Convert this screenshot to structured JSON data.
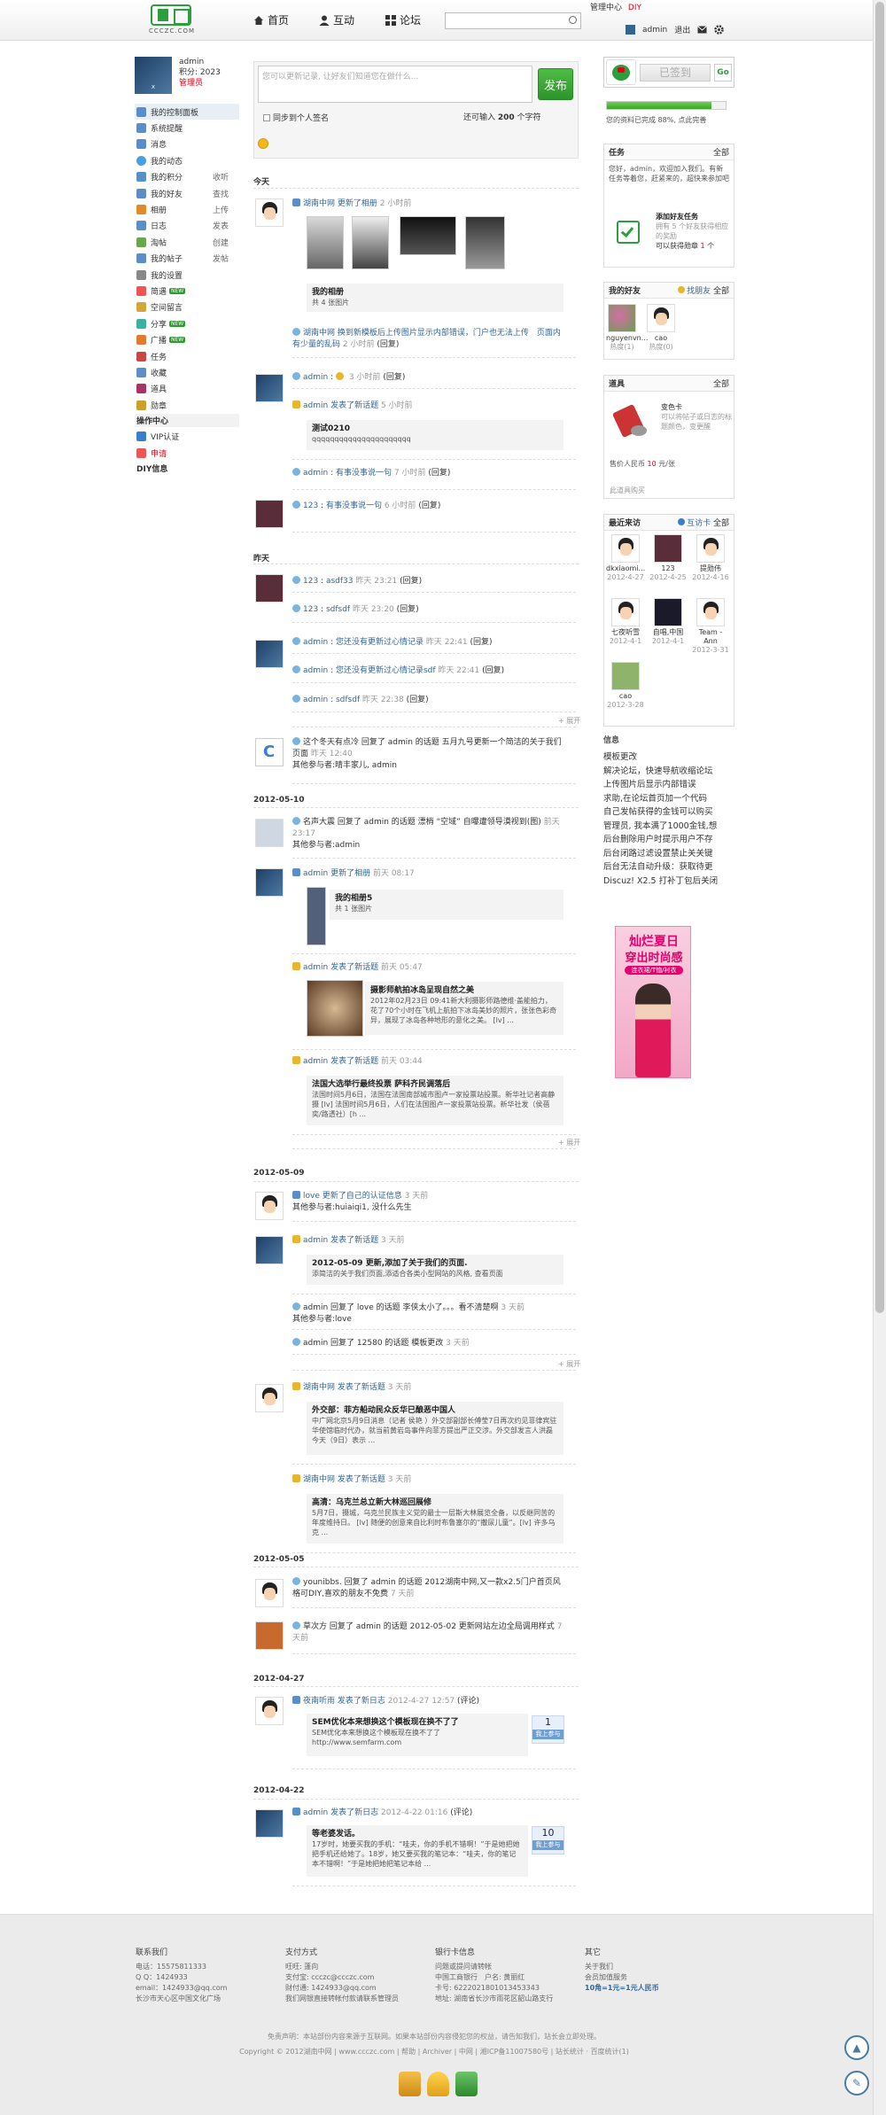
{
  "header": {
    "logo_sub": "CCCZC.COM",
    "nav": [
      "首页",
      "互动",
      "论坛"
    ],
    "search_placeholder": "",
    "toplinks": [
      "管理中心",
      "DIY"
    ],
    "username": "admin",
    "exit": "退出"
  },
  "profile": {
    "name": "admin",
    "points": "积分: 2023",
    "role": "管理员"
  },
  "menu": {
    "items": [
      {
        "label": "我的控制面板",
        "right": ""
      },
      {
        "label": "系统提醒",
        "right": ""
      },
      {
        "label": "消息",
        "right": ""
      },
      {
        "label": "我的动态",
        "right": ""
      },
      {
        "label": "我的积分",
        "right": "收听"
      },
      {
        "label": "我的好友",
        "right": "查找"
      },
      {
        "label": "相册",
        "right": "上传"
      },
      {
        "label": "日志",
        "right": "发表"
      },
      {
        "label": "淘帖",
        "right": "创建"
      },
      {
        "label": "我的帖子",
        "right": "发帖"
      },
      {
        "label": "我的设置",
        "right": ""
      },
      {
        "label": "简遇",
        "right": "",
        "new": "NEW"
      },
      {
        "label": "空间留言",
        "right": ""
      },
      {
        "label": "分享",
        "right": "",
        "new": "NEW"
      },
      {
        "label": "广播",
        "right": "",
        "new": "NEW"
      },
      {
        "label": "任务",
        "right": ""
      },
      {
        "label": "收藏",
        "right": ""
      },
      {
        "label": "道具",
        "right": ""
      },
      {
        "label": "勋章",
        "right": ""
      }
    ],
    "section": "操作中心",
    "ops": [
      "VIP认证",
      "申请"
    ],
    "diy": "DIY信息"
  },
  "publish": {
    "placeholder": "您可以更新记录, 让好友们知道您在做什么...",
    "button": "发布",
    "sync": "同步到个人签名",
    "count_pre": "还可输入 ",
    "count": "200",
    "count_post": " 个字符"
  },
  "days": [
    "今天",
    "昨天",
    "2012-05-10",
    "2012-05-09",
    "2012-05-05",
    "2012-04-27",
    "2012-04-22"
  ],
  "feed": {
    "f1": {
      "user": "湖南中网",
      "action": "更新了相册",
      "time": "2 小时前",
      "album": "我的相册",
      "album_sub": "共 4 张图片"
    },
    "f2": {
      "user": "湖南中网",
      "link": "换到新模板后上传图片显示内部错误，门户也无法上传　页面内有少量的乱码",
      "time": "2 小时前",
      "tail": "(回复)"
    },
    "f3": {
      "user": "admin",
      "time": "3 小时前",
      "tail": "(回复)"
    },
    "f4": {
      "user": "admin",
      "action": "发表了新话题",
      "time": "5 小时前",
      "title": "测试0210",
      "body": "qqqqqqqqqqqqqqqqqqqqqq"
    },
    "f5": {
      "user": "admin",
      "link": "有事没事说一句",
      "time": "7 小时前",
      "tail": "(回复)"
    },
    "f6": {
      "user": "123",
      "link": "有事没事说一句",
      "time": "6 小时前",
      "tail": "(回复)"
    },
    "y1": {
      "user": "123",
      "link": "asdf33",
      "time": "昨天 23:21",
      "tail": "(回复)"
    },
    "y2": {
      "user": "123",
      "link": "sdfsdf",
      "time": "昨天 23:20",
      "tail": "(回复)"
    },
    "y3": {
      "user": "admin",
      "link": "您还没有更新过心情记录",
      "time": "昨天 22:41",
      "tail": "(回复)"
    },
    "y4": {
      "user": "admin",
      "link": "您还没有更新过心情记录sdf",
      "time": "昨天 22:41",
      "tail": "(回复)"
    },
    "y5": {
      "user": "admin",
      "link": "sdfsdf",
      "time": "昨天 22:38",
      "tail": "(回复)"
    },
    "expand": "展开",
    "c1": {
      "text": "这个冬天有点冷 回复了 admin 的话题 五月九号更新一个简洁的关于我们页面",
      "time": "昨天 12:40",
      "sub": "其他参与者:晴丰家儿, admin"
    },
    "d1": {
      "text": "名声大震 回复了 admin 的话题 漂梢 “空域” 自曝遭领导漠视到(图)",
      "time": "前天 23:17",
      "sub": "其他参与者:admin"
    },
    "d2": {
      "user": "admin",
      "action": "更新了相册",
      "time": "前天 08:17",
      "album": "我的相册5",
      "album_sub": "共 1 张图片"
    },
    "d3": {
      "user": "admin",
      "action": "发表了新话题",
      "time": "前天 05:47",
      "title": "摄影师航拍冰岛呈现自然之美",
      "body": "2012年02月23日 09:41新大利摄影师路德维·盖能拍力，花了70个小时在飞机上航拍下冰岛美妙的照片，张张色彩奇异，展现了冰岛各种地形的意化之美。 [lv] ..."
    },
    "d4": {
      "user": "admin",
      "action": "发表了新话题",
      "time": "前天 03:44",
      "title": "法国大选举行最终投票 萨科齐民调落后",
      "body": "法国时间5月6日，法国在法国南部城市图卢一家投票站投票。新华社记者高静摄 [lv] 法国时间5月6日，人们在法国图卢一家投票站投票。新华社发（侯蓓奕/路透社）[h ..."
    },
    "e1": {
      "user": "love",
      "action": "更新了自己的认证信息",
      "time": "3 天前",
      "sub": "其他参与者:huiaiqi1, 没什么先生"
    },
    "e2": {
      "user": "admin",
      "action": "发表了新话题",
      "time": "3 天前",
      "title": "2012-05-09 更新,添加了关于我们的页面.",
      "body": "添简洁的关于我们页面,添适合各类小型网站的风格, 查看页面"
    },
    "e3": {
      "text": "admin 回复了 love 的话题 李侠太小了。。。看不清楚啊",
      "time": "3 天前",
      "sub": "其他参与者:love"
    },
    "e4": {
      "text": "admin 回复了 12580 的话题 模板更改",
      "time": "3 天前"
    },
    "e5": {
      "user": "湖南中网",
      "action": "发表了新话题",
      "time": "3 天前",
      "title": "外交部：菲方船动民众反华已酿恶中国人",
      "body": "中广网北京5月9日消息（记者 侯艳 ）外交部副部长傅莹7日再次约见菲律宾驻华使馆临时代办，就当前黄岩岛事件向菲方提出严正交涉。外交部发言人洪磊今天（9日）表示 ..."
    },
    "e6": {
      "user": "湖南中网",
      "action": "发表了新话题",
      "time": "3 天前",
      "title": "高清：乌克兰总立新大林巡回展修",
      "body": "5月7日，摄城，乌克兰民族主义党的最士一层斯大林展览全备，以反继同苦的年度维持日。 [lv] 随便的创意来自比利时布鲁塞尔的“撒尿儿童”。[lv] 许多乌克 ..."
    },
    "g1": {
      "text": "younibbs. 回复了 admin 的话题 2012湖南中网,又一款x2.5门户首页风格可DIY,喜欢的朋友不免费",
      "time": "7 天前"
    },
    "g2": {
      "text": "草次方 回复了 admin 的话题 2012-05-02 更新网站左边全局调用样式",
      "time": "7 天前"
    },
    "h1": {
      "user": "夜南听雨",
      "action": "发表了新日志",
      "time": "2012-4-27 12:57",
      "tail": "(评论)",
      "title": "SEM优化本来想换这个模板现在换不了了",
      "body": "SEM优化本来想换这个模板现在换不了了",
      "url": "http://www.semfarm.com",
      "vote": "1",
      "vote_label": "我上参与"
    },
    "i1": {
      "user": "admin",
      "action": "发表了新日志",
      "time": "2012-4-22 01:16",
      "tail": "(评论)",
      "title": "等老婆发话。",
      "body": "17岁时，她要买我的手机：“哇夫，你的手机不错啊！”于是她把她把手机还给她了。18岁，她又要买我的笔记本：“哇夫，你的笔记本不错啊！”于是她把她把笔记本给 ...",
      "vote": "10",
      "vote_label": "我上参与"
    }
  },
  "right": {
    "sign": "已签到",
    "sign_go": "Go",
    "progress": 0.88,
    "progress_text": "您的资料已完成 88%, 点此完善",
    "tasks": {
      "title": "任务",
      "all": "全部",
      "intro": "您好，admin，欢迎加入我们。有新任务等着您，赶紧来的，超快来参加吧",
      "task_name": "添加好友任务",
      "task_desc": "拥有 5 个好友获得相应的奖励",
      "task_reward_pre": "可以获得勋章 ",
      "task_reward": "1",
      "task_reward_post": " 个"
    },
    "friends": {
      "title": "我的好友",
      "search": "找朋友",
      "all": "全部",
      "list": [
        {
          "name": "nguyenvn...",
          "sub": "热度(1)"
        },
        {
          "name": "cao",
          "sub": "热度(0)"
        }
      ]
    },
    "props": {
      "title": "道具",
      "all": "全部",
      "name": "变色卡",
      "desc": "可以将帖子或日志的标题颜色，变更醒",
      "price_pre": "售价人民币 ",
      "price": "10",
      "price_post": " 元/张",
      "link": "此道具购买"
    },
    "visitors": {
      "title": "最近来访",
      "mutual": "互访卡",
      "all": "全部",
      "list": [
        {
          "name": "dkxiaomi...",
          "date": "2012-4-27"
        },
        {
          "name": "123",
          "date": "2012-4-25"
        },
        {
          "name": "提勋伟",
          "date": "2012-4-16"
        },
        {
          "name": "七夜听雪",
          "date": "2012-4-1"
        },
        {
          "name": "自唱,中国",
          "date": "2012-4-1"
        },
        {
          "name": "Team - Ann",
          "date": "2012-3-31"
        },
        {
          "name": "cao",
          "date": "2012-3-28"
        }
      ]
    },
    "info": {
      "title": "信息",
      "lines": [
        "模板更改",
        "解决论坛，快速导航收缩论坛",
        "上传图片后显示内部错误",
        "求助,在论坛首页加一个代码",
        "自己发帖获得的金钱可以购买",
        "管理员, 我本满了1000金钱,想",
        "后台删除用户时提示用户不存",
        "后台闭路过滤设置禁止关关键",
        "后台无法自动升级：获取待更",
        "Discuz! X2.5 打补丁包后关闭"
      ]
    },
    "ad": {
      "line1": "灿烂夏日",
      "line2": "穿出时尚感",
      "line3": "连衣裙/T恤/衬衣"
    }
  },
  "footer": {
    "cols": [
      {
        "title": "联系我们",
        "lines": [
          "电话：15575811333",
          "Q Q：1424933",
          "email：1424933@qq.com",
          "长沙市天心区中国文化广场"
        ]
      },
      {
        "title": "支付方式",
        "lines": [
          "旺旺: 蓬向",
          "支付宝: ccczc@ccczc.com",
          "财付通: 1424933@qq.com",
          "我们网银直接转帐付款请联系管理员"
        ]
      },
      {
        "title": "银行卡信息",
        "lines": [
          "问题或提问请转帐",
          "中国工商银行　户名: 黄丽红",
          "卡号: 6222021801013453343",
          "地址: 湖南省长沙市雨花区韶山路支行"
        ]
      },
      {
        "title": "其它",
        "lines": [
          "关于我们",
          "会员加值服务",
          "10角=1元=1元人民币"
        ]
      }
    ],
    "disclaimer": "免责声明：本站部份内容来源于互联网。如果本站部份内容侵犯您的权益，请告知我们，站长会立即处理。",
    "copyright": "Copyright © 2012湖南中网 | www.ccczc.com | 帮助 | Archiver | 中网 | 湘ICP备11007580号 | 站长统计 · 百度统计(1)"
  },
  "colors": {
    "accent": "#336699",
    "brand": "#2c9e3e",
    "red": "#e60012"
  }
}
